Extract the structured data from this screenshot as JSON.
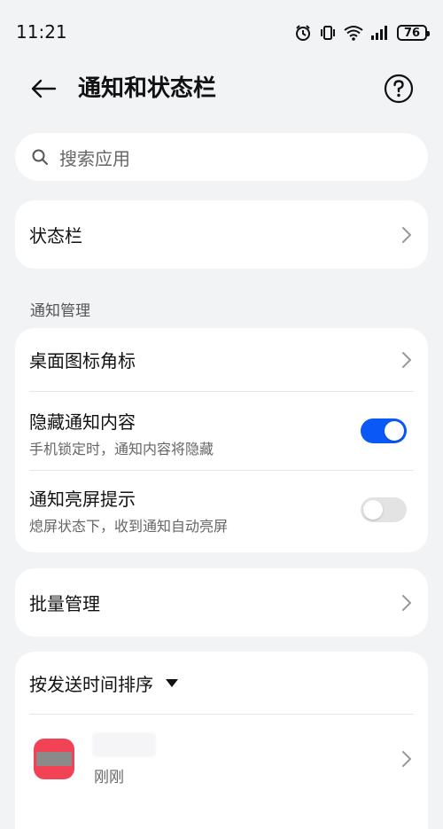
{
  "status_bar": {
    "time": "11:21",
    "battery": "76",
    "icons": [
      "alarm-icon",
      "vibrate-icon",
      "wifi-icon",
      "signal-icon",
      "battery-icon"
    ]
  },
  "header": {
    "title": "通知和状态栏",
    "back_icon": "back-arrow-icon",
    "help_icon": "help-icon"
  },
  "search": {
    "placeholder": "搜索应用"
  },
  "status_bar_card": {
    "label": "状态栏"
  },
  "notification_section": {
    "label": "通知管理",
    "items": [
      {
        "title": "桌面图标角标"
      },
      {
        "title": "隐藏通知内容",
        "subtitle": "手机锁定时，通知内容将隐藏",
        "toggle": true
      },
      {
        "title": "通知亮屏提示",
        "subtitle": "熄屏状态下，收到通知自动亮屏",
        "toggle": false
      }
    ]
  },
  "batch": {
    "label": "批量管理"
  },
  "sort": {
    "label": "按发送时间排序"
  },
  "app_list": [
    {
      "time": "刚刚"
    }
  ],
  "colors": {
    "accent": "#0a59f7",
    "background": "#f1f3f5",
    "card": "#ffffff",
    "app_icon": "#f24256"
  }
}
